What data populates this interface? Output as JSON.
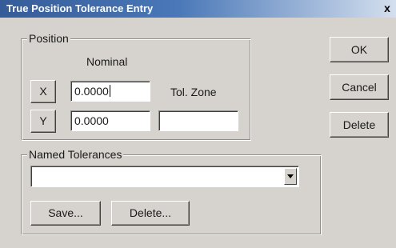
{
  "window": {
    "title": "True Position Tolerance Entry",
    "close_glyph": "x"
  },
  "position_group": {
    "title": "Position",
    "nominal_label": "Nominal",
    "tol_zone_label": "Tol. Zone",
    "x_button": "X",
    "y_button": "Y",
    "x_value": "0.0000",
    "y_value": "0.0000",
    "tol_zone_value": ""
  },
  "named_group": {
    "title": "Named Tolerances",
    "selected_value": "",
    "save_button": "Save...",
    "delete_button": "Delete..."
  },
  "actions": {
    "ok": "OK",
    "cancel": "Cancel",
    "delete": "Delete"
  },
  "colors": {
    "title_bar_start": "#355c99",
    "face": "#d6d3ce"
  }
}
